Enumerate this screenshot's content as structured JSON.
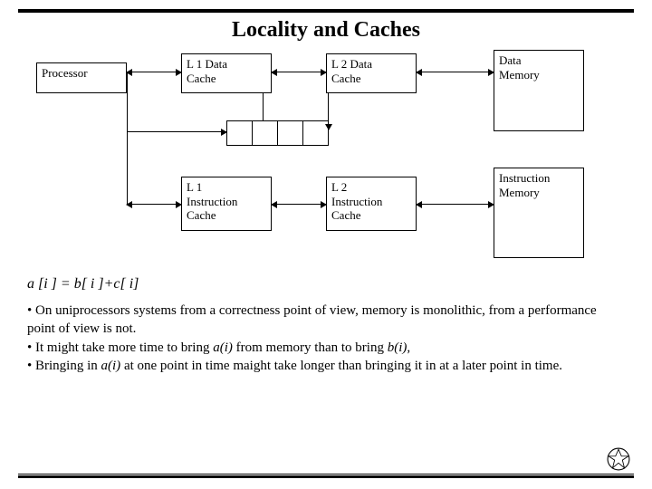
{
  "title": "Locality and Caches",
  "boxes": {
    "processor": "Processor",
    "l1d": {
      "l1": "L 1 Data",
      "l2": "Cache"
    },
    "l2d": {
      "l1": "L 2 Data",
      "l2": "Cache"
    },
    "dmem": {
      "l1": "Data",
      "l2": "Memory"
    },
    "l1i": {
      "l1": "L 1",
      "l2": "Instruction",
      "l3": "Cache"
    },
    "l2i": {
      "l1": "L 2",
      "l2": "Instruction",
      "l3": "Cache"
    },
    "imem": {
      "l1": "Instruction",
      "l2": "Memory"
    }
  },
  "formula": "a [i ] = b[ i ]+c[ i]",
  "bullets": {
    "b1": "• On uniprocessors systems from a correctness point of view, memory is monolithic, from a performance point of view is not.",
    "b2a": "• It might take more time to bring ",
    "b2i1": "a(i)",
    "b2b": " from memory than to bring ",
    "b2i2": "b(i)",
    "b2c": ",",
    "b3a": "• Bringing in ",
    "b3i1": "a(i)",
    "b3b": " at one point in time maight take longer than bringing it in at a later point in time."
  }
}
